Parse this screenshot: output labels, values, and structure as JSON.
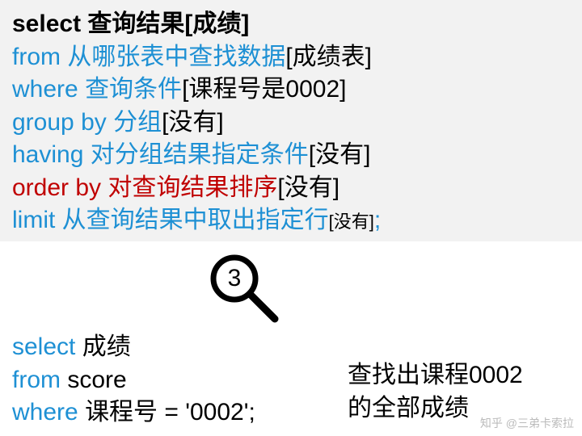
{
  "top": {
    "l1": {
      "kw": "select",
      "desc": "查询结果",
      "val": "[成绩]"
    },
    "l2": {
      "kw": "from",
      "desc": "从哪张表中查找数据",
      "val": "[成绩表]"
    },
    "l3": {
      "kw": "where",
      "desc": "查询条件",
      "val": "[课程号是0002]"
    },
    "l4": {
      "kw": "group by",
      "desc": "分组",
      "val": "[没有]"
    },
    "l5": {
      "kw": "having",
      "desc": "对分组结果指定条件",
      "val": "[没有]"
    },
    "l6": {
      "kw": "order by",
      "desc": "对查询结果排序",
      "val": "[没有]"
    },
    "l7": {
      "kw": "limit",
      "desc": "从查询结果中取出指定行",
      "val": "[没有]",
      "tail": ";"
    }
  },
  "step": "3",
  "query": {
    "l1": {
      "kw": "select",
      "rest": "成绩"
    },
    "l2": {
      "kw": "from",
      "rest": "score"
    },
    "l3": {
      "kw": "where",
      "rest": "课程号 = '0002';"
    }
  },
  "note": {
    "l1": "查找出课程0002",
    "l2": "的全部成绩"
  },
  "watermark": "知乎 @三弟卡索拉"
}
